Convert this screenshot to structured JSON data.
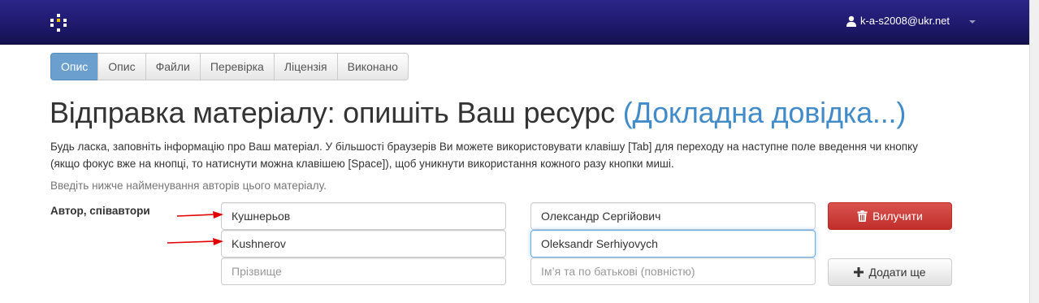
{
  "header": {
    "user_email": "k-a-s2008@ukr.net"
  },
  "steps": [
    {
      "label": "Опис",
      "active": true
    },
    {
      "label": "Опис",
      "active": false
    },
    {
      "label": "Файли",
      "active": false
    },
    {
      "label": "Перевірка",
      "active": false
    },
    {
      "label": "Ліцензія",
      "active": false
    },
    {
      "label": "Виконано",
      "active": false
    }
  ],
  "page": {
    "title": "Відправка матеріалу: опишіть Ваш ресурс",
    "help_link": "(Докладна довідка...)",
    "intro_line1": "Будь ласка, заповніть інформацію про Ваш матеріал. У більшості браузерів Ви можете використовувати клавішу [Tab] для переходу на наступне поле введення чи кнопку",
    "intro_line2": "(якщо фокус вже на кнопці, то натиснути можна клавішею [Space]), щоб уникнути використання кожного разу кнопки миші.",
    "hint": "Введіть нижче найменування авторів цього матеріалу."
  },
  "authors": {
    "label": "Автор, співавтори",
    "rows": [
      {
        "last_name": "Кушнерьов",
        "first_name": "Олександр Сергійович"
      },
      {
        "last_name": "Kushnerov",
        "first_name": "Oleksandr Serhiyovych"
      }
    ],
    "placeholder_last": "Прізвище",
    "placeholder_first": "Ім’я та по батькові (повністю)",
    "remove_button": "Вилучити",
    "add_button": "Додати ще"
  },
  "colors": {
    "navbar": "#1f1a6e",
    "active_step": "#6b9fce",
    "link": "#428bca",
    "danger": "#d9534f",
    "annotation_arrow": "#e00000"
  },
  "icons": {
    "user": "user-icon",
    "trash": "trash-icon",
    "plus": "plus-icon"
  }
}
